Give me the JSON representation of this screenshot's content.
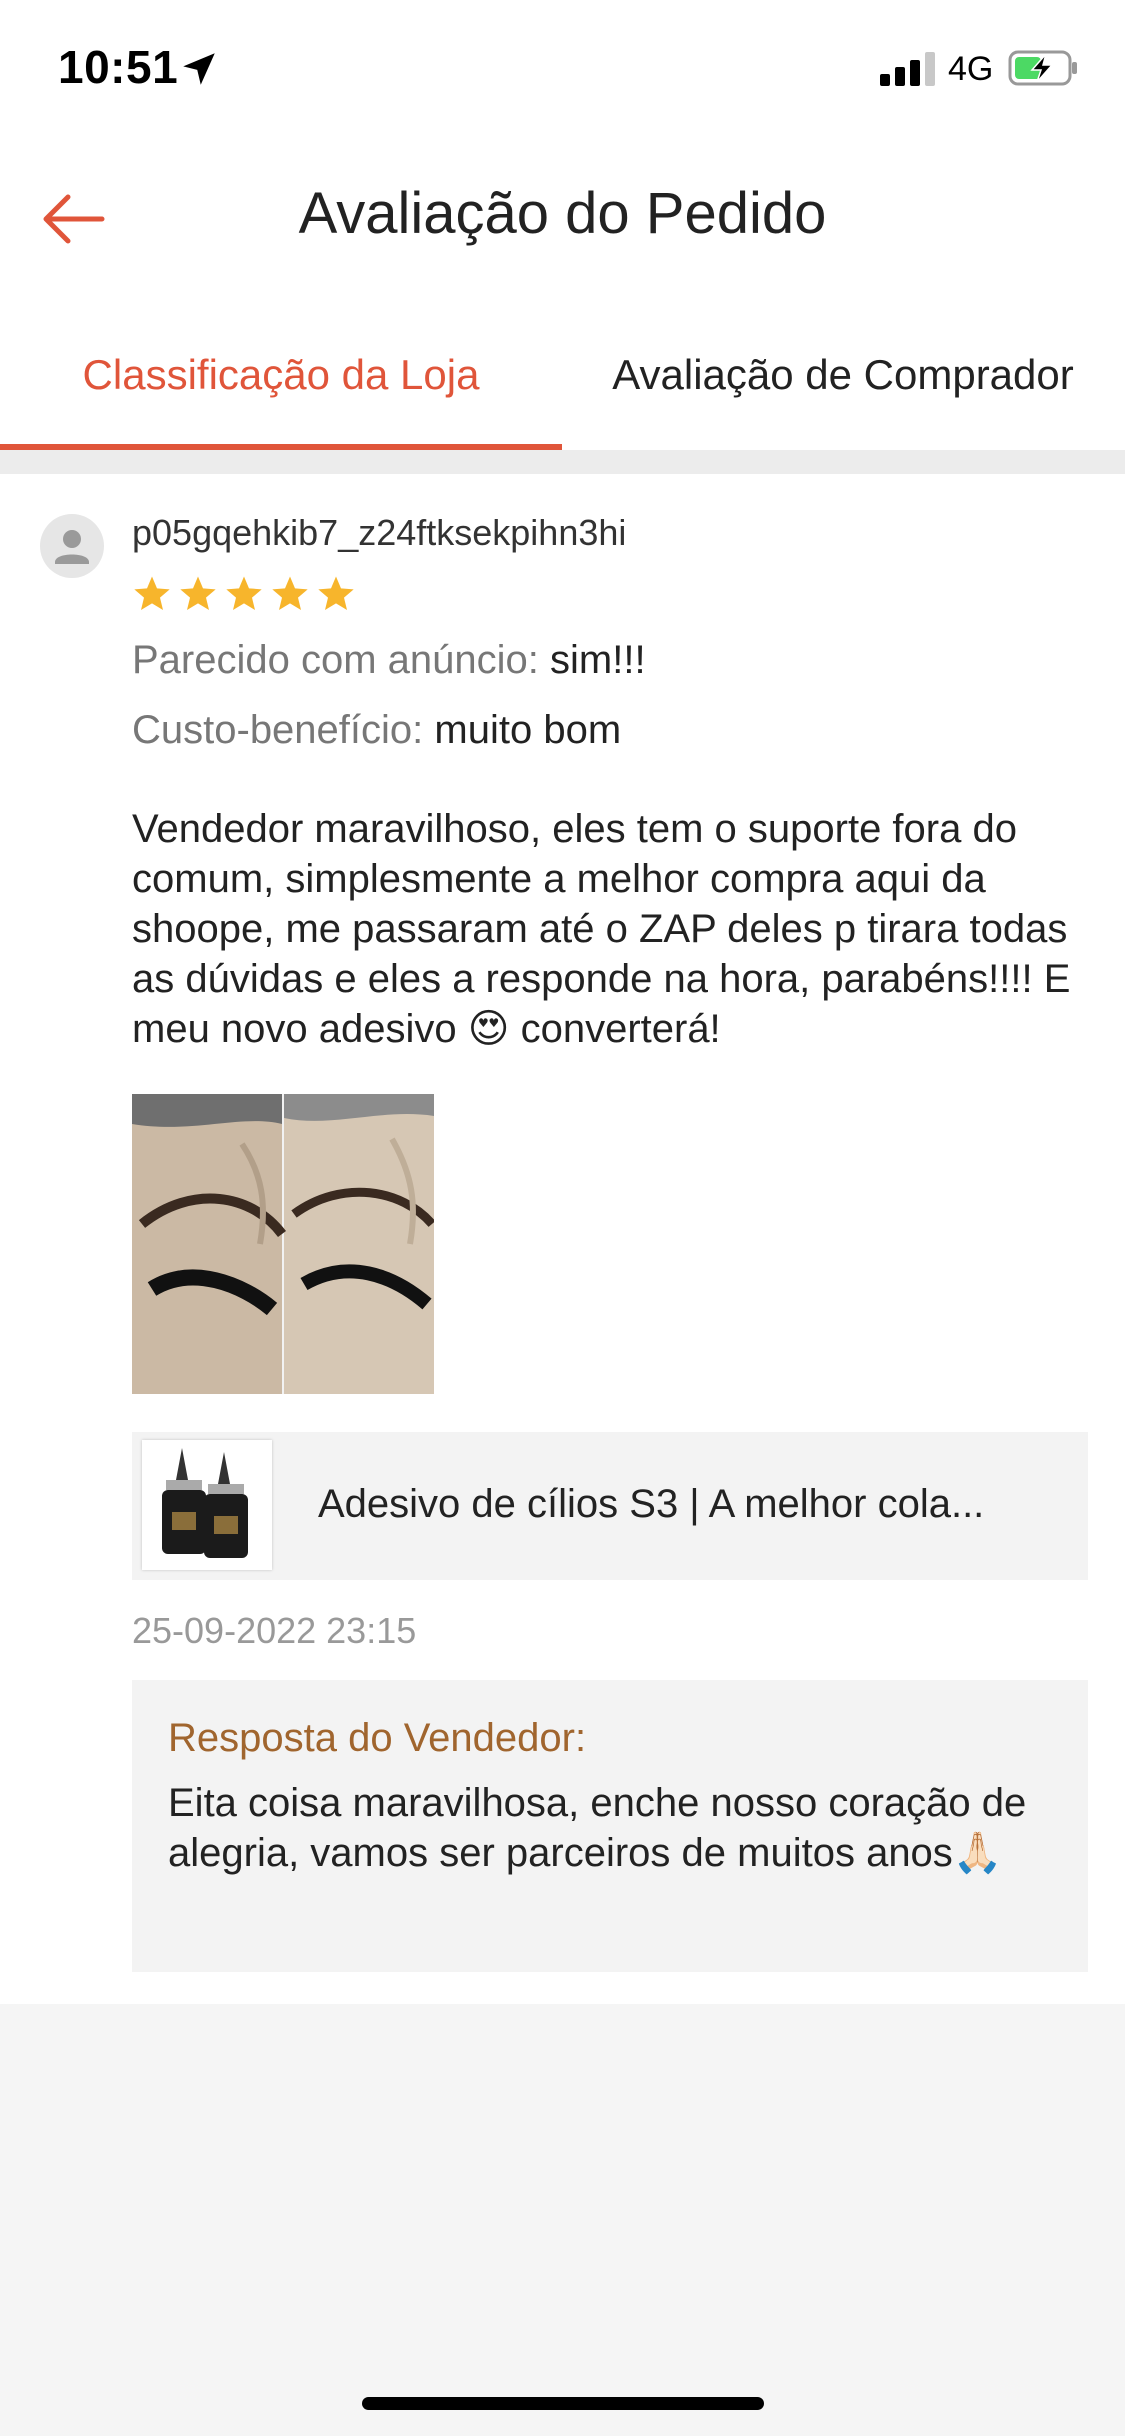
{
  "status_bar": {
    "time": "10:51",
    "network": "4G",
    "location_icon": "location-arrow-icon",
    "signal_icon": "cellular-signal-icon",
    "battery_icon": "battery-charging-icon"
  },
  "header": {
    "title": "Avaliação do Pedido",
    "back_icon": "arrow-left-icon",
    "accent_color": "#e0553a"
  },
  "tabs": [
    {
      "label": "Classificação da Loja",
      "active": true
    },
    {
      "label": "Avaliação de Comprador",
      "active": false
    }
  ],
  "review": {
    "username": "p05gqehkib7_z24ftksekpihn3hi",
    "rating": 5,
    "rating_max": 5,
    "attributes": [
      {
        "label": "Parecido com anúncio:",
        "value": "sim!!!"
      },
      {
        "label": "Custo-benefício:",
        "value": "muito bom"
      }
    ],
    "text": "Vendedor maravilhoso, eles tem o suporte  fora do comum, simplesmente a melhor compra aqui da shoope, me passaram até o ZAP deles p tirara todas as dúvidas e eles a responde na hora, parabéns!!!! E meu novo adesivo 😍 converterá!",
    "photo_icon": "review-photo-eyelashes",
    "product": {
      "name": "Adesivo de cílios S3 | A melhor cola...",
      "thumb_icon": "glue-bottles-thumbnail"
    },
    "date": "25-09-2022 23:15",
    "seller_reply": {
      "label": "Resposta do Vendedor:",
      "text": "Eita coisa maravilhosa, enche nosso coração de alegria, vamos ser parceiros de muitos anos🙏🏻"
    }
  }
}
